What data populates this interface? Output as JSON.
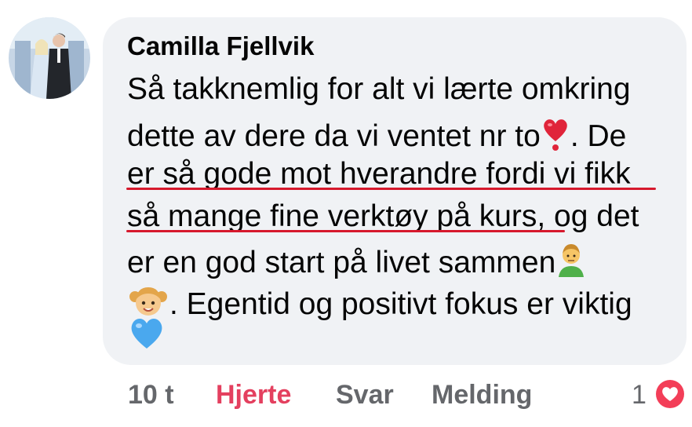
{
  "comment": {
    "author": "Camilla Fjellvik",
    "lines": [
      "Så takknemlig for alt vi lærte omkring",
      "dette av dere da vi ventet nr to",
      ". De",
      "er så gode mot hverandre fordi vi fikk",
      "så mange fine verktøy på kurs, og det",
      "er en god start på livet sammen",
      ". Egentid og positivt fokus er viktig"
    ],
    "emojis": [
      "red-heart",
      "man-emoji",
      "girl-emoji",
      "blue-heart"
    ]
  },
  "actions": {
    "time": "10 t",
    "heart": "Hjerte",
    "reply": "Svar",
    "message": "Melding"
  },
  "reactions": {
    "count": "1",
    "type": "heart-reaction"
  },
  "colors": {
    "bubble": "#f0f2f5",
    "text": "#050505",
    "muted": "#65676b",
    "heart_action": "#e4405f",
    "underline": "#d6192d"
  }
}
